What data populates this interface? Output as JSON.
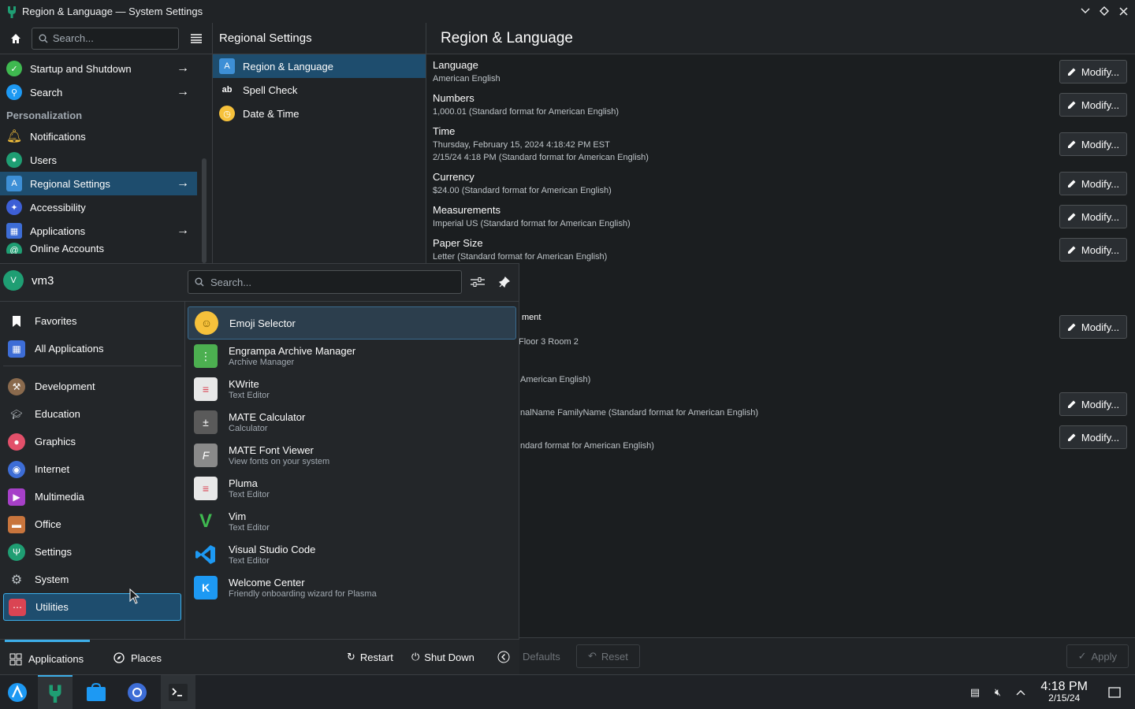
{
  "window": {
    "title": "Region & Language — System Settings",
    "controls": [
      "minimize",
      "maximize",
      "close"
    ]
  },
  "sidebar": {
    "search_placeholder": "Search...",
    "items": [
      {
        "label": "Startup and Shutdown",
        "icon": "power-icon",
        "color": "#3fb950",
        "arrow": true
      },
      {
        "label": "Search",
        "icon": "search-icon",
        "color": "#1d99f3",
        "arrow": true
      }
    ],
    "section_label": "Personalization",
    "personal_items": [
      {
        "label": "Notifications",
        "icon": "bell-icon",
        "color": "#f6c13b"
      },
      {
        "label": "Users",
        "icon": "users-icon",
        "color": "#1f9e73"
      },
      {
        "label": "Regional Settings",
        "icon": "regional-icon",
        "color": "#3d8fd6",
        "arrow": true,
        "active": true
      },
      {
        "label": "Accessibility",
        "icon": "accessibility-icon",
        "color": "#3d5fd6"
      },
      {
        "label": "Applications",
        "icon": "applications-icon",
        "color": "#3d6dd6",
        "arrow": true
      },
      {
        "label": "Online Accounts",
        "icon": "online-accounts-icon",
        "color": "#1f9e73"
      }
    ]
  },
  "middle": {
    "title": "Regional Settings",
    "items": [
      {
        "label": "Region & Language",
        "active": true
      },
      {
        "label": "Spell Check"
      },
      {
        "label": "Date & Time"
      }
    ]
  },
  "content": {
    "title": "Region & Language",
    "modify_label": "Modify...",
    "rows": [
      {
        "label": "Language",
        "value": "American English"
      },
      {
        "label": "Numbers",
        "value": "1,000.01 (Standard format for American English)"
      },
      {
        "label": "Time",
        "value": "Thursday, February 15, 2024 4:18:42 PM EST",
        "value2": "2/15/24 4:18 PM (Standard format for American English)"
      },
      {
        "label": "Currency",
        "value": "$24.00 (Standard format for American English)"
      },
      {
        "label": "Measurements",
        "value": "Imperial US (Standard format for American English)"
      },
      {
        "label": "Paper Size",
        "value": "Letter (Standard format for American English)"
      }
    ],
    "partial_rows": [
      {
        "text": "ment"
      },
      {
        "text": "Floor 3 Room 2"
      },
      {
        "text": "American English)"
      },
      {
        "text": "nalName FamilyName (Standard format for American English)"
      },
      {
        "text": "ndard format for American English)"
      }
    ],
    "footer": {
      "defaults": "Defaults",
      "reset": "Reset",
      "apply": "Apply"
    }
  },
  "launcher": {
    "user": "vm3",
    "avatar_letter": "V",
    "search_placeholder": "Search...",
    "categories": [
      {
        "label": "Favorites",
        "icon": "bookmark-icon"
      },
      {
        "label": "All Applications",
        "icon": "grid-icon"
      }
    ],
    "groups": [
      {
        "label": "Development",
        "icon": "hammer-icon",
        "color": "#8a6a4d"
      },
      {
        "label": "Education",
        "icon": "graduation-cap-icon",
        "color": "#4d4d4d"
      },
      {
        "label": "Graphics",
        "icon": "palette-icon",
        "color": "#e2506a"
      },
      {
        "label": "Internet",
        "icon": "globe-icon",
        "color": "#3d6dd6"
      },
      {
        "label": "Multimedia",
        "icon": "multimedia-icon",
        "color": "#a640c8"
      },
      {
        "label": "Office",
        "icon": "briefcase-icon",
        "color": "#c8753d"
      },
      {
        "label": "Settings",
        "icon": "settings-icon",
        "color": "#1f9e73"
      },
      {
        "label": "System",
        "icon": "gear-icon",
        "color": "#7f8c8d"
      },
      {
        "label": "Utilities",
        "icon": "utilities-icon",
        "color": "#da4453",
        "active": true
      }
    ],
    "apps": [
      {
        "name": "Emoji Selector",
        "desc": "",
        "icon": "emoji-icon",
        "color": "#f6c13b",
        "active": true
      },
      {
        "name": "Engrampa Archive Manager",
        "desc": "Archive Manager",
        "icon": "archive-icon",
        "color": "#4caf50"
      },
      {
        "name": "KWrite",
        "desc": "Text Editor",
        "icon": "text-editor-icon",
        "color": "#e8e8e8"
      },
      {
        "name": "MATE Calculator",
        "desc": "Calculator",
        "icon": "calculator-icon",
        "color": "#5a5a5a"
      },
      {
        "name": "MATE Font Viewer",
        "desc": "View fonts on your system",
        "icon": "font-icon",
        "color": "#8a8a8a"
      },
      {
        "name": "Pluma",
        "desc": "Text Editor",
        "icon": "text-editor-icon",
        "color": "#e8e8e8"
      },
      {
        "name": "Vim",
        "desc": "Text Editor",
        "icon": "vim-icon",
        "color": "#1f9e3d"
      },
      {
        "name": "Visual Studio Code",
        "desc": "Text Editor",
        "icon": "vscode-icon",
        "color": "#1d99f3"
      },
      {
        "name": "Welcome Center",
        "desc": "Friendly onboarding wizard for Plasma",
        "icon": "kde-icon",
        "color": "#1d99f3"
      }
    ],
    "footer": {
      "applications": "Applications",
      "places": "Places",
      "restart": "Restart",
      "shutdown": "Shut Down"
    }
  },
  "taskbar": {
    "time": "4:18 PM",
    "date": "2/15/24"
  }
}
